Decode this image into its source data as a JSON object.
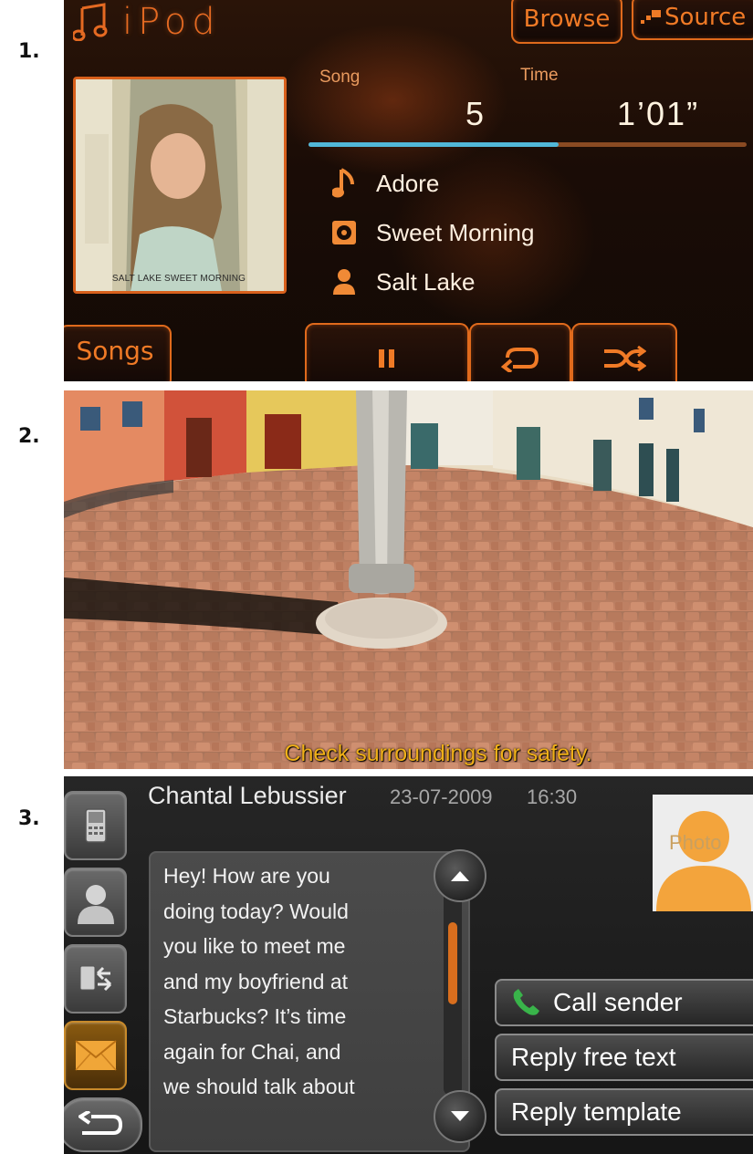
{
  "labels": [
    "1.",
    "2.",
    "3."
  ],
  "ipod": {
    "title": "iPod",
    "browse_label": "Browse",
    "source_label": "Source",
    "song_label": "Song",
    "time_label": "Time",
    "song_number": "5",
    "time_value": "1’01”",
    "progress_fraction": 0.57,
    "album_caption": "SALT LAKE  SWEET MORNING",
    "track_title": "Adore",
    "album_name": "Sweet Morning",
    "artist_name": "Salt Lake",
    "songs_button_label": "Songs",
    "icons": {
      "logo": "music-note-icon",
      "source": "source-icon",
      "track": "music-note-icon",
      "album": "album-disc-icon",
      "artist": "person-icon",
      "pause": "pause-icon",
      "repeat": "repeat-icon",
      "shuffle": "shuffle-icon"
    },
    "colors": {
      "accent": "#e06a1c",
      "progress": "#51b7d8"
    }
  },
  "camera": {
    "safety_text": "Check surroundings for safety."
  },
  "sms": {
    "sender_name": "Chantal Lebussier",
    "date": "23-07-2009",
    "time": "16:30",
    "photo_label": "Photo",
    "message": "Hey! How are you\ndoing today? Would\nyou like to meet me\nand my boyfriend at\nStarbucks? It’s time\nagain for Chai, and\nwe should talk about",
    "actions": [
      "Call sender",
      "Reply free text",
      "Reply template"
    ],
    "sidebar_icons": [
      "phone-icon",
      "contacts-icon",
      "call-log-icon",
      "message-envelope-icon",
      "back-arrow-icon"
    ]
  }
}
